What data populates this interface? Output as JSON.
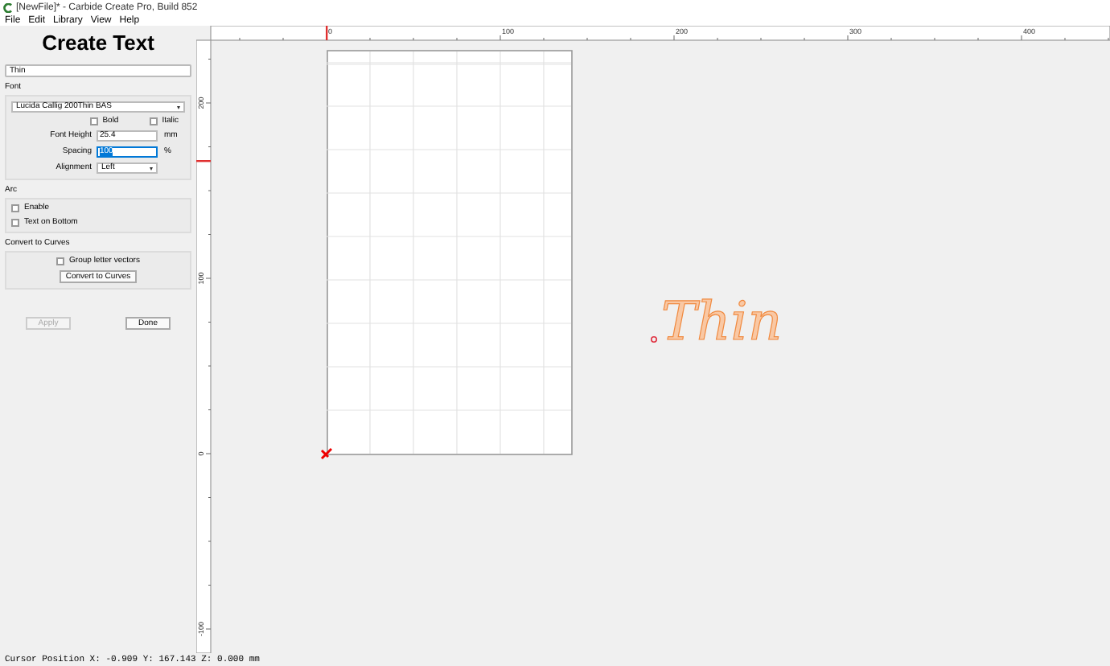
{
  "window": {
    "title": "[NewFile]* - Carbide Create Pro, Build 852"
  },
  "menu": [
    "File",
    "Edit",
    "Library",
    "View",
    "Help"
  ],
  "panel": {
    "heading": "Create Text",
    "text_value": "Thin",
    "font_section": {
      "label": "Font",
      "font": "Lucida Callig 200Thin BAS",
      "options": [
        {
          "label": "Bold",
          "checked": false
        },
        {
          "label": "Italic",
          "checked": false
        }
      ],
      "fields": [
        {
          "label": "Font Height",
          "value": "25.4",
          "unit": "mm",
          "selected": false
        },
        {
          "label": "Spacing",
          "value": "100",
          "unit": "%",
          "selected": true
        }
      ],
      "alignment": {
        "label": "Alignment",
        "value": "Left"
      }
    },
    "arc_section": {
      "label": "Arc",
      "options": [
        {
          "label": "Enable",
          "checked": false
        },
        {
          "label": "Text on Bottom",
          "checked": false
        }
      ]
    },
    "curves_section": {
      "label": "Convert to Curves",
      "option": {
        "label": "Group letter vectors",
        "checked": false
      },
      "button": "Convert to Curves"
    },
    "buttons": [
      {
        "label": "Apply",
        "disabled": true
      },
      {
        "label": "Done",
        "disabled": false
      }
    ]
  },
  "canvas": {
    "x_ruler": [
      "0",
      "100",
      "200",
      "300",
      "400"
    ],
    "y_ruler": [
      "200",
      "100",
      "0",
      "-100"
    ],
    "text": "Thin"
  },
  "status_bar": "Cursor Position X: -0.909 Y: 167.143 Z: 0.000 mm"
}
